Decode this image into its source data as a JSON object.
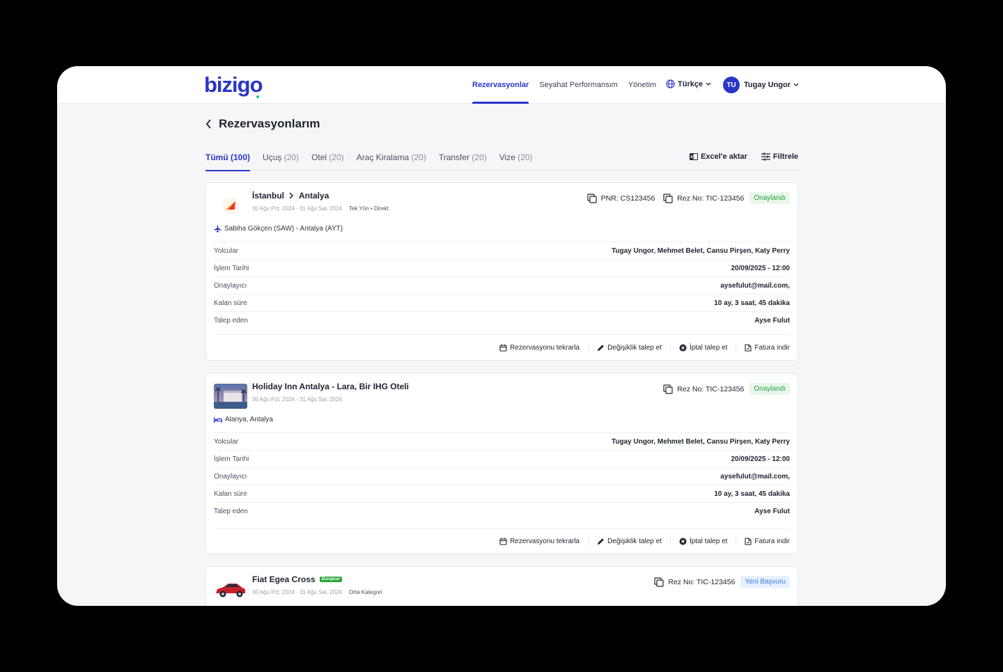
{
  "header": {
    "logo": "bizigo",
    "nav": [
      "Rezervasyonlar",
      "Seyahat Performansım",
      "Yönetim"
    ],
    "language": "Türkçe",
    "user_initials": "TU",
    "user_name": "Tugay Ungor"
  },
  "page": {
    "title": "Rezervasyonlarım",
    "tabs": [
      {
        "label": "Tümü",
        "count": "(100)"
      },
      {
        "label": "Uçuş",
        "count": "(20)"
      },
      {
        "label": "Otel",
        "count": "(20)"
      },
      {
        "label": "Araç Kiralama",
        "count": "(20)"
      },
      {
        "label": "Transfer",
        "count": "(20)"
      },
      {
        "label": "Vize",
        "count": "(20)"
      }
    ],
    "export_label": "Excel'e aktar",
    "filter_label": "Filtrele"
  },
  "row_labels": [
    "Yolcular",
    "İşlem Tarihi",
    "Onaylayıcı",
    "Kalan süre",
    "Talep eden"
  ],
  "actions": [
    "Rezervasyonu tekrarla",
    "Değişiklik talep et",
    "İptal talep et",
    "Fatura indir"
  ],
  "cards": [
    {
      "from": "İstanbul",
      "to": "Antalya",
      "dates": "30 Ağu Pzt, 2024 - 31 Ağu Sal, 2024",
      "extra": "Tek Yön • Direkt",
      "pnr": "PNR: CS123456",
      "rez_no": "Rez No: TIC-123456",
      "status": "Onaylandı",
      "route": "Sabiha Gökçen (SAW) - Antalya (AYT)",
      "values": [
        "Tugay Ungor, Mehmet Belet, Cansu Pirşen, Katy Perry",
        "20/09/2025 - 12:00",
        "aysefulut@mail.com,",
        "10 ay, 3 saat, 45 dakika",
        "Ayse Fulut"
      ]
    },
    {
      "title": "Holiday Inn Antalya - Lara, Bir IHG Oteli",
      "dates": "30 Ağu Pzt, 2024 - 31 Ağu Sal, 2024",
      "rez_no": "Rez No: TIC-123456",
      "status": "Onaylandı",
      "location": "Alanya, Antalya",
      "values": [
        "Tugay Ungor, Mehmet Belet, Cansu Pirşen, Katy Perry",
        "20/09/2025 - 12:00",
        "aysefulut@mail.com,",
        "10 ay, 3 saat, 45 dakika",
        "Ayse Fulut"
      ]
    },
    {
      "title": "Fiat Egea Cross",
      "brand": "Europcar",
      "dates": "30 Ağu Pzt, 2024 - 31 Ağu Sal, 2024",
      "extra": "Orta Kategori",
      "rez_no": "Rez No: TIC-123456",
      "status": "Yeni Başvuru"
    }
  ],
  "colors": {
    "accent": "#2a35c7",
    "approved": "#29a046",
    "new": "#3a7be0"
  }
}
